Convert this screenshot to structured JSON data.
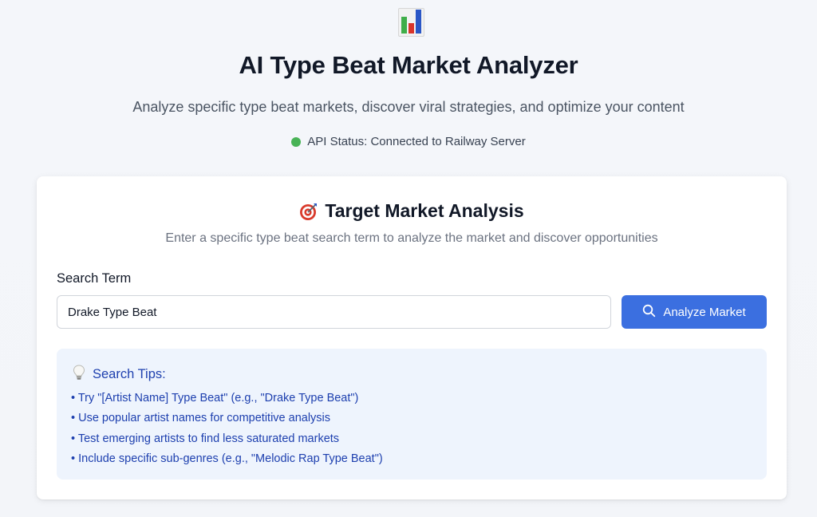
{
  "header": {
    "logo_icon": "bar-chart-icon",
    "title": "AI Type Beat Market Analyzer",
    "subtitle": "Analyze specific type beat markets, discover viral strategies, and optimize your content",
    "status_text": "API Status: Connected to Railway Server",
    "status_color": "#48b356"
  },
  "card": {
    "title_icon": "target-icon",
    "title": "Target Market Analysis",
    "description": "Enter a specific type beat search term to analyze the market and discover opportunities",
    "field_label": "Search Term",
    "search_value": "Drake Type Beat",
    "button_icon": "search-icon",
    "button_label": "Analyze Market",
    "accent_color": "#3b6fe0"
  },
  "tips": {
    "icon": "lightbulb-icon",
    "heading": "Search Tips:",
    "items": [
      "• Try \"[Artist Name] Type Beat\" (e.g., \"Drake Type Beat\")",
      "• Use popular artist names for competitive analysis",
      "• Test emerging artists to find less saturated markets",
      "• Include specific sub-genres (e.g., \"Melodic Rap Type Beat\")"
    ]
  }
}
